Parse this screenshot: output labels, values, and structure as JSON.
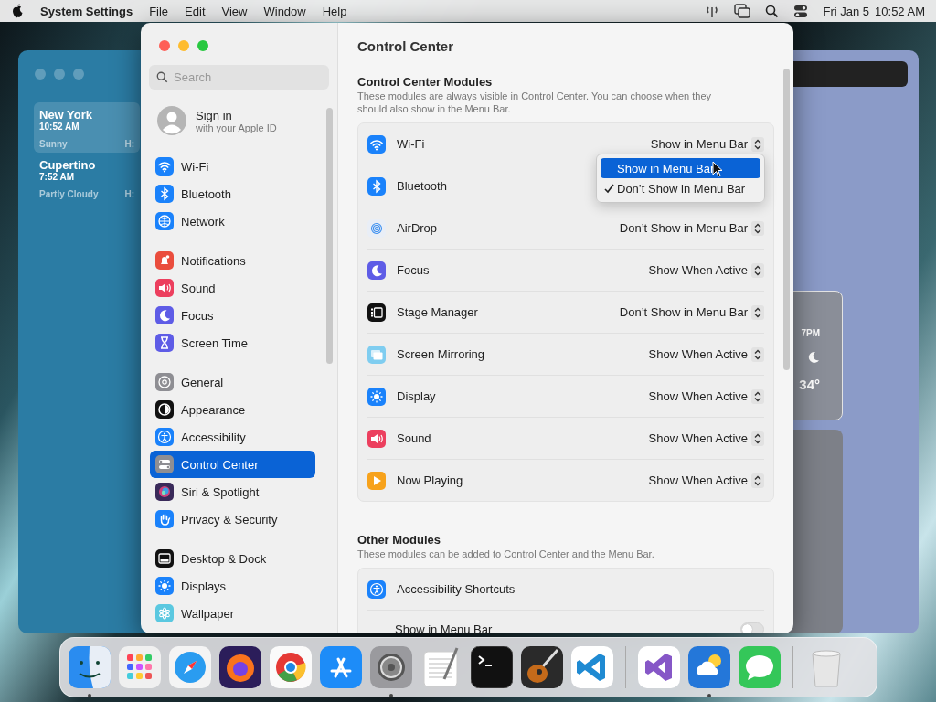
{
  "menu_bar": {
    "app_name": "System Settings",
    "menus": [
      "File",
      "Edit",
      "View",
      "Window",
      "Help"
    ],
    "date": "Fri Jan 5",
    "time": "10:52 AM"
  },
  "weather_window": {
    "locations": [
      {
        "city": "New York",
        "time": "10:52 AM",
        "condition": "Sunny",
        "high": "H:",
        "selected": true
      },
      {
        "city": "Cupertino",
        "time": "7:52 AM",
        "condition": "Partly Cloudy",
        "high": "H:",
        "selected": false
      }
    ]
  },
  "weather_side": {
    "hour": "7PM",
    "temperature": "34°"
  },
  "settings": {
    "title": "Control Center",
    "search": {
      "placeholder": "Search"
    },
    "account": {
      "title": "Sign in",
      "subtitle": "with your Apple ID"
    },
    "sidebar_groups": [
      [
        {
          "label": "Wi-Fi",
          "kind": "wifi",
          "selected": false
        },
        {
          "label": "Bluetooth",
          "kind": "bluetooth",
          "selected": false
        },
        {
          "label": "Network",
          "kind": "network",
          "selected": false
        }
      ],
      [
        {
          "label": "Notifications",
          "kind": "notifications",
          "selected": false
        },
        {
          "label": "Sound",
          "kind": "sound",
          "selected": false
        },
        {
          "label": "Focus",
          "kind": "focus",
          "selected": false
        },
        {
          "label": "Screen Time",
          "kind": "screentime",
          "selected": false
        }
      ],
      [
        {
          "label": "General",
          "kind": "general",
          "selected": false
        },
        {
          "label": "Appearance",
          "kind": "appearance",
          "selected": false
        },
        {
          "label": "Accessibility",
          "kind": "accessibility",
          "selected": false
        },
        {
          "label": "Control Center",
          "kind": "controlcenter",
          "selected": true
        },
        {
          "label": "Siri & Spotlight",
          "kind": "siri",
          "selected": false
        },
        {
          "label": "Privacy & Security",
          "kind": "privacy",
          "selected": false
        }
      ],
      [
        {
          "label": "Desktop & Dock",
          "kind": "desktop",
          "selected": false
        },
        {
          "label": "Displays",
          "kind": "displays",
          "selected": false
        },
        {
          "label": "Wallpaper",
          "kind": "wallpaper",
          "selected": false
        }
      ]
    ],
    "modules_section": {
      "title": "Control Center Modules",
      "description": "These modules are always visible in Control Center. You can choose when they should also show in the Menu Bar.",
      "modules": [
        {
          "label": "Wi-Fi",
          "kind": "wifi",
          "value": "Show in Menu Bar"
        },
        {
          "label": "Bluetooth",
          "kind": "bluetooth"
        },
        {
          "label": "AirDrop",
          "kind": "airdrop",
          "value": "Don’t Show in Menu Bar"
        },
        {
          "label": "Focus",
          "kind": "focus",
          "value": "Show When Active"
        },
        {
          "label": "Stage Manager",
          "kind": "stage",
          "value": "Don’t Show in Menu Bar"
        },
        {
          "label": "Screen Mirroring",
          "kind": "mirroring",
          "value": "Show When Active"
        },
        {
          "label": "Display",
          "kind": "displays",
          "value": "Show When Active"
        },
        {
          "label": "Sound",
          "kind": "sound",
          "value": "Show When Active"
        },
        {
          "label": "Now Playing",
          "kind": "nowplaying",
          "value": "Show When Active"
        }
      ]
    },
    "dropdown": {
      "options": [
        {
          "label": "Show in Menu Bar",
          "selected": true,
          "checked": false
        },
        {
          "label": "Don’t Show in Menu Bar",
          "selected": false,
          "checked": true
        }
      ]
    },
    "other_section": {
      "title": "Other Modules",
      "description": "These modules can be added to Control Center and the Menu Bar.",
      "module": {
        "label": "Accessibility Shortcuts",
        "kind": "accessibility"
      },
      "toggle": {
        "label": "Show in Menu Bar",
        "on": false
      }
    }
  },
  "dock": {
    "apps": [
      {
        "kind": "finder",
        "running": true
      },
      {
        "kind": "launchpad",
        "running": false
      },
      {
        "kind": "safari",
        "running": false
      },
      {
        "kind": "firefox",
        "running": false
      },
      {
        "kind": "chrome",
        "running": false
      },
      {
        "kind": "appstore",
        "running": false
      },
      {
        "kind": "settings",
        "running": true
      },
      {
        "kind": "textedit",
        "running": false
      },
      {
        "kind": "terminal",
        "running": false
      },
      {
        "kind": "garageband",
        "running": false
      },
      {
        "kind": "vscode",
        "running": false
      },
      {
        "kind": "divider"
      },
      {
        "kind": "visualstudio",
        "running": false
      },
      {
        "kind": "weather",
        "running": true
      },
      {
        "kind": "messages",
        "running": false
      },
      {
        "kind": "divider"
      },
      {
        "kind": "trash",
        "running": false
      }
    ]
  }
}
